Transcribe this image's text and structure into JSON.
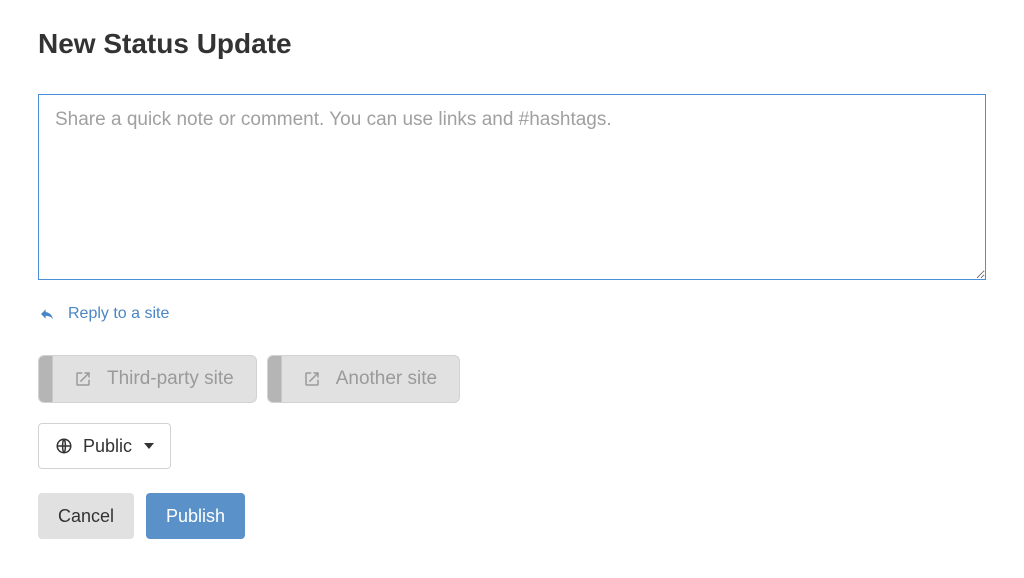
{
  "header": {
    "title": "New Status Update"
  },
  "composer": {
    "placeholder": "Share a quick note or comment. You can use links and #hashtags.",
    "value": ""
  },
  "reply_link": {
    "label": "Reply to a site"
  },
  "share_targets": [
    {
      "label": "Third-party site"
    },
    {
      "label": "Another site"
    }
  ],
  "visibility": {
    "selected": "Public"
  },
  "actions": {
    "cancel_label": "Cancel",
    "publish_label": "Publish"
  },
  "colors": {
    "accent": "#5a91c8",
    "link": "#4a86c5",
    "border_focus": "#4b8fd4"
  }
}
